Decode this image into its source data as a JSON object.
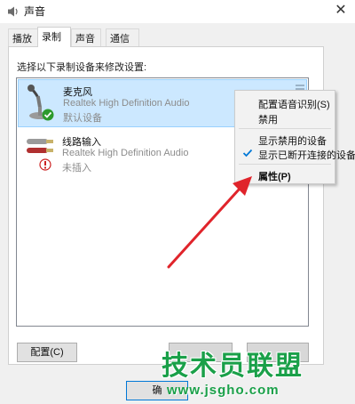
{
  "window": {
    "title": "声音",
    "close_glyph": "✕"
  },
  "tabs": [
    {
      "label": "播放"
    },
    {
      "label": "录制",
      "active": true
    },
    {
      "label": "声音"
    },
    {
      "label": "通信"
    }
  ],
  "instruction": "选择以下录制设备来修改设置:",
  "devices": [
    {
      "name": "麦克风",
      "driver": "Realtek High Definition Audio",
      "status": "默认设备",
      "icon": "microphone-icon",
      "badge": "default-check-icon",
      "selected": true
    },
    {
      "name": "线路输入",
      "driver": "Realtek High Definition Audio",
      "status": "未插入",
      "icon": "line-in-jack-icon",
      "badge": "unplugged-icon",
      "selected": false
    }
  ],
  "buttons": {
    "configure": "配置(C)",
    "ok_partial": "确"
  },
  "context_menu": {
    "items": [
      {
        "label": "配置语音识别(S)",
        "checked": false
      },
      {
        "label": "禁用",
        "checked": false
      },
      {
        "label": "显示禁用的设备",
        "checked": false
      },
      {
        "label": "显示已断开连接的设备",
        "checked": true
      },
      {
        "label": "属性(P)",
        "checked": false,
        "bold": true
      }
    ]
  },
  "watermark": {
    "text": "技术员联盟",
    "url": "www.jsgho.com",
    "color": "#1aa049"
  },
  "colors": {
    "selection": "#cce8ff",
    "annotation_arrow": "#e0242b",
    "check": "#0078d7"
  }
}
